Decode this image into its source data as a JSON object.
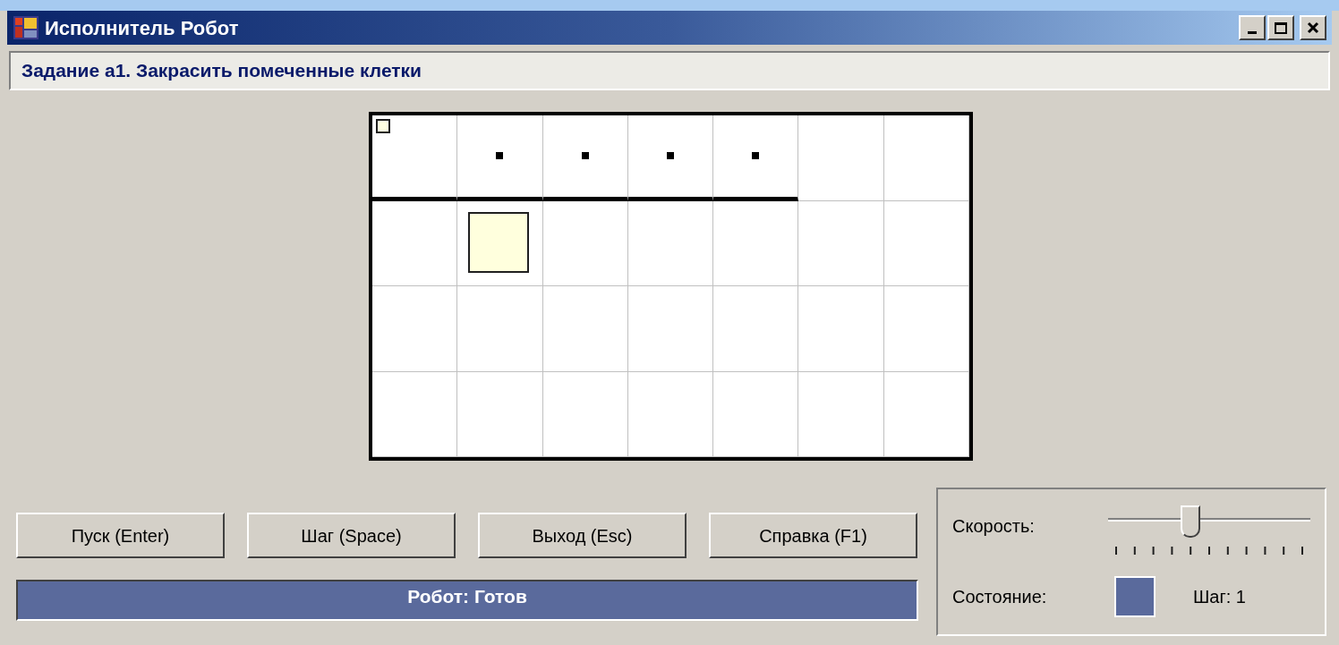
{
  "window": {
    "title": "Исполнитель Робот"
  },
  "task": "Задание а1. Закрасить помеченные клетки",
  "field": {
    "rows": [
      [
        {
          "kind": "start",
          "wall_below": true
        },
        {
          "kind": "marked",
          "wall_below": true
        },
        {
          "kind": "marked",
          "wall_below": true
        },
        {
          "kind": "marked",
          "wall_below": true
        },
        {
          "kind": "marked",
          "wall_below": true
        },
        {
          "kind": "empty",
          "wall_below": false
        },
        {
          "kind": "empty",
          "wall_below": false
        }
      ],
      [
        {
          "kind": "empty",
          "wall_below": false
        },
        {
          "kind": "robot",
          "wall_below": false
        },
        {
          "kind": "empty",
          "wall_below": false
        },
        {
          "kind": "empty",
          "wall_below": false
        },
        {
          "kind": "empty",
          "wall_below": false
        },
        {
          "kind": "empty",
          "wall_below": false
        },
        {
          "kind": "empty",
          "wall_below": false
        }
      ],
      [
        {
          "kind": "empty",
          "wall_below": false
        },
        {
          "kind": "empty",
          "wall_below": false
        },
        {
          "kind": "empty",
          "wall_below": false
        },
        {
          "kind": "empty",
          "wall_below": false
        },
        {
          "kind": "empty",
          "wall_below": false
        },
        {
          "kind": "empty",
          "wall_below": false
        },
        {
          "kind": "empty",
          "wall_below": false
        }
      ],
      [
        {
          "kind": "empty"
        },
        {
          "kind": "empty"
        },
        {
          "kind": "empty"
        },
        {
          "kind": "empty"
        },
        {
          "kind": "empty"
        },
        {
          "kind": "empty"
        },
        {
          "kind": "empty"
        }
      ]
    ]
  },
  "buttons": [
    "Пуск (Enter)",
    "Шаг (Space)",
    "Выход (Esc)",
    "Справка (F1)"
  ],
  "status": "Робот: Готов",
  "speed": {
    "label": "Скорость:",
    "level": 0.4
  },
  "state": {
    "label": "Состояние:",
    "color": "#5a6a9c",
    "step": "Шаг: 1"
  }
}
